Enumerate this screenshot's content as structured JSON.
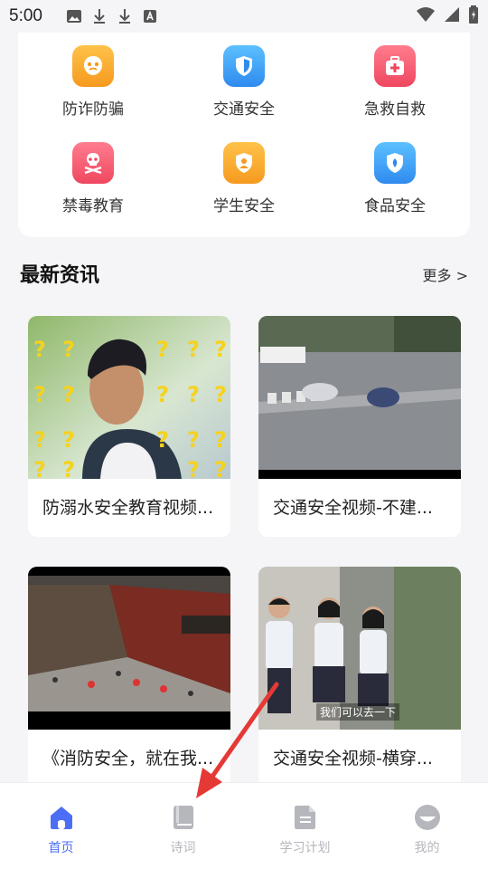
{
  "status_bar": {
    "time": "5:00"
  },
  "categories": [
    {
      "label": "防诈防骗",
      "icon": "mask-icon",
      "color": "#f5a524"
    },
    {
      "label": "交通安全",
      "icon": "shield-icon",
      "color": "#3aa0f3"
    },
    {
      "label": "急救自救",
      "icon": "first-aid-icon",
      "color": "#f2536b"
    },
    {
      "label": "禁毒教育",
      "icon": "skull-icon",
      "color": "#f2536b"
    },
    {
      "label": "学生安全",
      "icon": "student-badge-icon",
      "color": "#f5a524"
    },
    {
      "label": "食品安全",
      "icon": "food-shield-icon",
      "color": "#3aa0f3"
    }
  ],
  "news_section": {
    "title": "最新资讯",
    "more": "更多 >"
  },
  "news": [
    {
      "title": "防溺水安全教育视频..."
    },
    {
      "title": "交通安全视频-不建..."
    },
    {
      "title": "《消防安全，就在我..."
    },
    {
      "title": "交通安全视频-横穿..."
    }
  ],
  "video_caption": "我们可以去一下",
  "tabs": [
    {
      "label": "首页",
      "icon": "home-icon",
      "active": true
    },
    {
      "label": "诗词",
      "icon": "book-icon",
      "active": false
    },
    {
      "label": "学习计划",
      "icon": "document-icon",
      "active": false
    },
    {
      "label": "我的",
      "icon": "profile-icon",
      "active": false
    }
  ],
  "colors": {
    "accent": "#4c6ef5",
    "inactive": "#b5b7bd",
    "arrow": "#e53935"
  }
}
